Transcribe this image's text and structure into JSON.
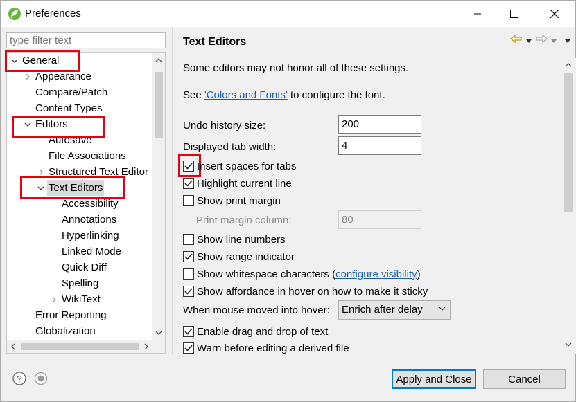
{
  "window": {
    "title": "Preferences"
  },
  "filter": {
    "placeholder": "type filter text"
  },
  "tree": [
    {
      "label": "General",
      "expander": "expanded",
      "level": 0
    },
    {
      "label": "Appearance",
      "expander": "collapsed",
      "level": 1
    },
    {
      "label": "Compare/Patch",
      "expander": "none",
      "level": 1
    },
    {
      "label": "Content Types",
      "expander": "none",
      "level": 1
    },
    {
      "label": "Editors",
      "expander": "expanded",
      "level": 1
    },
    {
      "label": "Autosave",
      "expander": "none",
      "level": 2
    },
    {
      "label": "File Associations",
      "expander": "none",
      "level": 2
    },
    {
      "label": "Structured Text Editor",
      "expander": "collapsed",
      "level": 2
    },
    {
      "label": "Text Editors",
      "expander": "expanded",
      "level": 2,
      "selected": true
    },
    {
      "label": "Accessibility",
      "expander": "none",
      "level": 3
    },
    {
      "label": "Annotations",
      "expander": "none",
      "level": 3
    },
    {
      "label": "Hyperlinking",
      "expander": "none",
      "level": 3
    },
    {
      "label": "Linked Mode",
      "expander": "none",
      "level": 3
    },
    {
      "label": "Quick Diff",
      "expander": "none",
      "level": 3
    },
    {
      "label": "Spelling",
      "expander": "none",
      "level": 3
    },
    {
      "label": "WikiText",
      "expander": "collapsed",
      "level": 3
    },
    {
      "label": "Error Reporting",
      "expander": "none",
      "level": 1
    },
    {
      "label": "Globalization",
      "expander": "none",
      "level": 1
    }
  ],
  "page": {
    "title": "Text Editors",
    "note": "Some editors may not honor all of these settings.",
    "see_prefix": "See ",
    "see_link": "'Colors and Fonts'",
    "see_suffix": " to configure the font.",
    "undo_label": "Undo history size:",
    "undo_value": "200",
    "tab_label": "Displayed tab width:",
    "tab_value": "4",
    "insert_spaces": "Insert spaces for tabs",
    "highlight_line": "Highlight current line",
    "show_print_margin": "Show print margin",
    "print_margin_label": "Print margin column:",
    "print_margin_value": "80",
    "show_line_numbers": "Show line numbers",
    "show_range": "Show range indicator",
    "show_whitespace": "Show whitespace characters (",
    "configure_visibility": "configure visibility",
    "close_paren": ")",
    "show_affordance": "Show affordance in hover on how to make it sticky",
    "hover_label": "When mouse moved into hover:",
    "hover_value": "Enrich after delay",
    "drag_drop": "Enable drag and drop of text",
    "warn_derived": "Warn before editing a derived file"
  },
  "checkboxes": {
    "insert_spaces": true,
    "highlight_line": true,
    "show_print_margin": false,
    "show_line_numbers": false,
    "show_range": true,
    "show_whitespace": false,
    "show_affordance": true,
    "drag_drop": true,
    "warn_derived": true
  },
  "buttons": {
    "apply_close": "Apply and Close",
    "cancel": "Cancel"
  },
  "colors": {
    "highlight": "#e8000d",
    "accent": "#0078d7",
    "link": "#1a5fb4"
  }
}
